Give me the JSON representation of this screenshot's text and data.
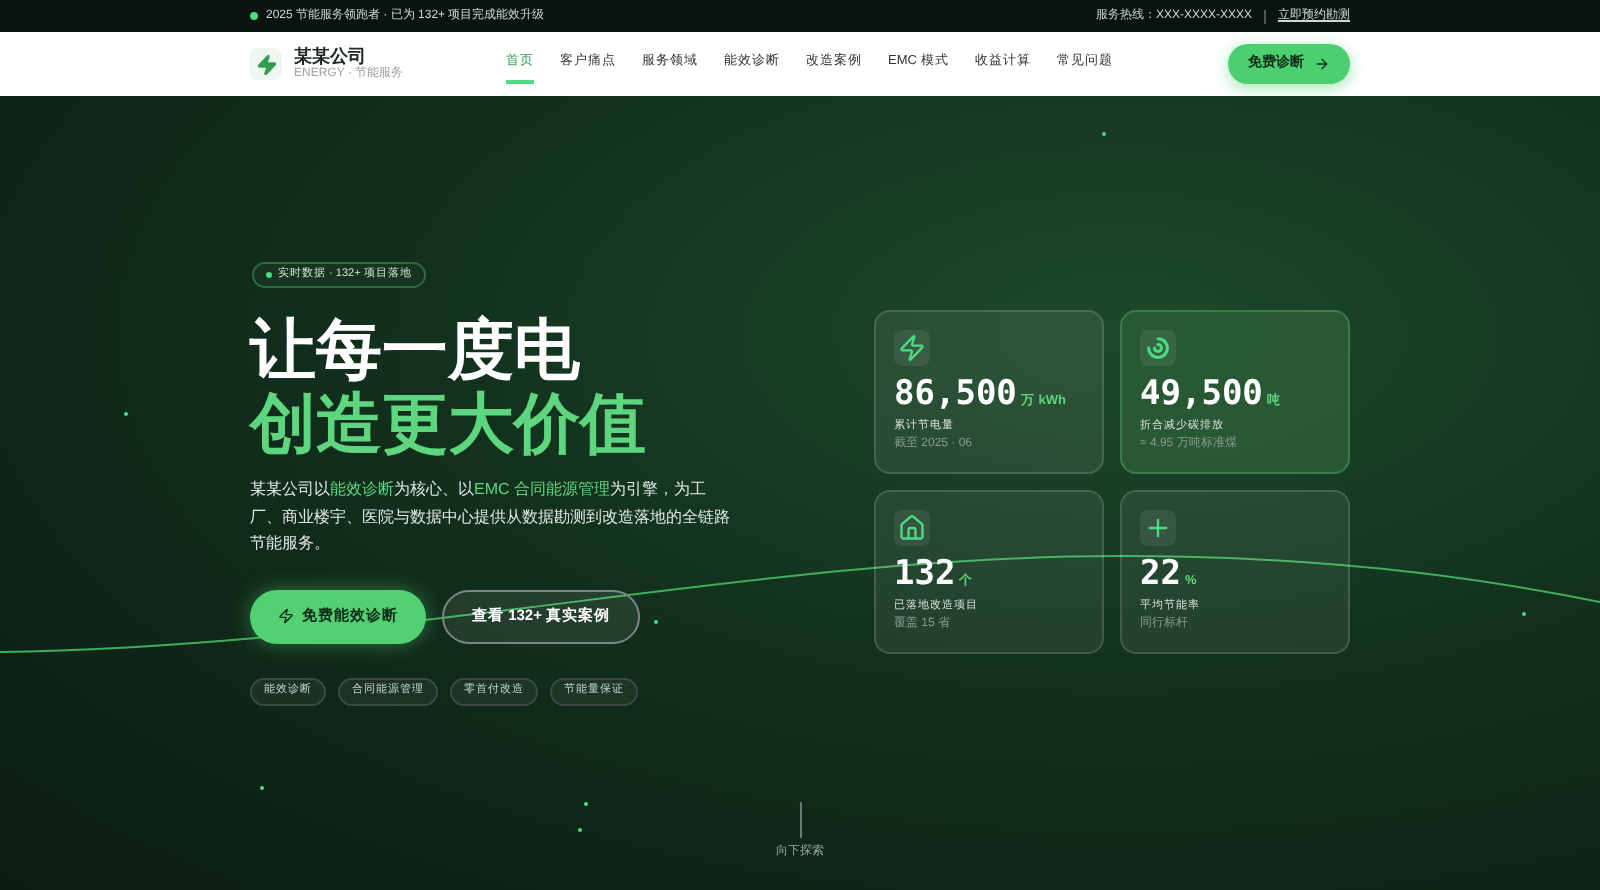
{
  "top_bar": {
    "announcement": "2025 节能服务领跑者 · 已为 132+ 项目完成能效升级",
    "hotline": "服务热线：XXX-XXXX-XXXX",
    "link": "立即预约勘测"
  },
  "brand": {
    "name": "某某公司",
    "tagline": "ENERGY · 节能服务"
  },
  "nav": [
    {
      "label": "首页",
      "selected": true
    },
    {
      "label": "客户痛点",
      "selected": false
    },
    {
      "label": "服务领域",
      "selected": false
    },
    {
      "label": "能效诊断",
      "selected": false
    },
    {
      "label": "改造案例",
      "selected": false
    },
    {
      "label": "EMC 模式",
      "selected": false
    },
    {
      "label": "收益计算",
      "selected": false
    },
    {
      "label": "常见问题",
      "selected": false
    }
  ],
  "nav_button": "免费诊断",
  "hero": {
    "badge": "实时数据 · 132+ 项目落地",
    "title_line_1": "让每一度电",
    "title_line_2": "创造更大价值",
    "description": "某某公司以**能效诊断**为核心、以**EMC 合同能源管理**为引擎，为工厂、商业楼宇、医院与数据中心提供从数据勘测到改造落地的全链路节能服务。",
    "primary_button": "免费能效诊断",
    "secondary_button": "查看 132+ 真实案例",
    "tags": [
      "能效诊断",
      "合同能源管理",
      "零首付改造",
      "节能量保证"
    ],
    "scroll_hint": "向下探索"
  },
  "stats": [
    {
      "kind": "bolt",
      "value": "86,500",
      "unit": "万 kWh",
      "label": "累计节电量",
      "note": "截至 2025 · 06",
      "highlighted": false
    },
    {
      "kind": "ring",
      "value": "49,500",
      "unit": "吨",
      "label": "折合减少碳排放",
      "note": "≈ 4.95 万吨标准煤",
      "highlighted": true
    },
    {
      "kind": "home",
      "value": "132",
      "unit": "个",
      "label": "已落地改造项目",
      "note": "覆盖 15 省",
      "highlighted": false
    },
    {
      "kind": "plus",
      "value": "22",
      "unit": "%",
      "label": "平均节能率",
      "note": "同行标杆",
      "highlighted": false
    }
  ]
}
